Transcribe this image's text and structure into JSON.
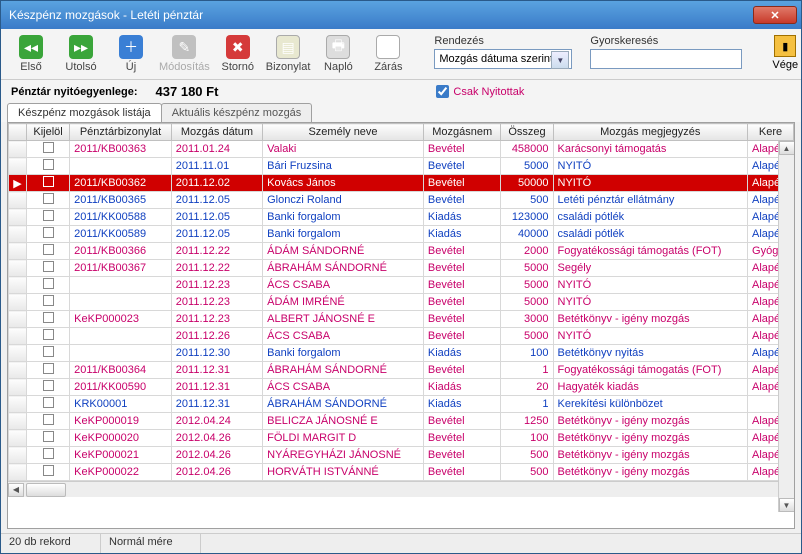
{
  "window": {
    "title": "Készpénz mozgások - Letéti pénztár"
  },
  "toolbar": {
    "first": "Első",
    "last": "Utolsó",
    "new": "Új",
    "edit": "Módosítás",
    "storno": "Stornó",
    "receipt": "Bizonylat",
    "log": "Napló",
    "close": "Zárás",
    "sort_label": "Rendezés",
    "sort_value": "Mozgás dátuma szerint",
    "search_label": "Gyorskeresés",
    "search_value": "",
    "end": "Vége"
  },
  "balance": {
    "label": "Pénztár nyitóegyenlege:",
    "value": "437 180 Ft"
  },
  "filter": {
    "only_open": "Csak Nyitottak",
    "checked": true
  },
  "tabs": {
    "active": "Készpénz mozgások listája",
    "other": "Aktuális készpénz mozgás"
  },
  "columns": [
    "Kijelöl",
    "Pénztárbizonylat",
    "Mozgás dátum",
    "Személy neve",
    "Mozgásnem",
    "Összeg",
    "Mozgás megjegyzés",
    "Kere"
  ],
  "rows": [
    {
      "c": "pink",
      "sel": false,
      "biz": "2011/KB00363",
      "dat": "2011.01.24",
      "nev": "Valaki",
      "nem": "Bevétel",
      "ossz": "458000",
      "meg": "Karácsonyi támogatás",
      "ker": "Alapér"
    },
    {
      "c": "blue",
      "sel": false,
      "biz": "",
      "dat": "2011.11.01",
      "nev": "Bári Fruzsina",
      "nem": "Bevétel",
      "ossz": "5000",
      "meg": "NYITÓ",
      "ker": "Alapér"
    },
    {
      "c": "pink",
      "sel": true,
      "biz": "2011/KB00362",
      "dat": "2011.12.02",
      "nev": "Kovács János",
      "nem": "Bevétel",
      "ossz": "50000",
      "meg": "NYITÓ",
      "ker": "Alapér"
    },
    {
      "c": "blue",
      "sel": false,
      "biz": "2011/KB00365",
      "dat": "2011.12.05",
      "nev": "Glonczi Roland",
      "nem": "Bevétel",
      "ossz": "500",
      "meg": "Letéti pénztár ellátmány",
      "ker": "Alapér"
    },
    {
      "c": "blue",
      "sel": false,
      "biz": "2011/KK00588",
      "dat": "2011.12.05",
      "nev": "Banki forgalom",
      "nem": "Kiadás",
      "ossz": "123000",
      "meg": "családi pótlék",
      "ker": "Alapér"
    },
    {
      "c": "blue",
      "sel": false,
      "biz": "2011/KK00589",
      "dat": "2011.12.05",
      "nev": "Banki forgalom",
      "nem": "Kiadás",
      "ossz": "40000",
      "meg": "családi pótlék",
      "ker": "Alapér"
    },
    {
      "c": "pink",
      "sel": false,
      "biz": "2011/KB00366",
      "dat": "2011.12.22",
      "nev": "ÁDÁM SÁNDORNÉ",
      "nem": "Bevétel",
      "ossz": "2000",
      "meg": "Fogyatékossági támogatás (FOT)",
      "ker": "Gyógy"
    },
    {
      "c": "pink",
      "sel": false,
      "biz": "2011/KB00367",
      "dat": "2011.12.22",
      "nev": "ÁBRAHÁM SÁNDORNÉ",
      "nem": "Bevétel",
      "ossz": "5000",
      "meg": "Segély",
      "ker": "Alapér"
    },
    {
      "c": "pink",
      "sel": false,
      "biz": "",
      "dat": "2011.12.23",
      "nev": "ÁCS CSABA",
      "nem": "Bevétel",
      "ossz": "5000",
      "meg": "NYITÓ",
      "ker": "Alapér"
    },
    {
      "c": "pink",
      "sel": false,
      "biz": "",
      "dat": "2011.12.23",
      "nev": "ÁDÁM IMRÉNÉ",
      "nem": "Bevétel",
      "ossz": "5000",
      "meg": "NYITÓ",
      "ker": "Alapér"
    },
    {
      "c": "pink",
      "sel": false,
      "biz": "KeKP000023",
      "dat": "2011.12.23",
      "nev": "ALBERT JÁNOSNÉ   E",
      "nem": "Bevétel",
      "ossz": "3000",
      "meg": "Betétkönyv - igény mozgás",
      "ker": "Alapér"
    },
    {
      "c": "pink",
      "sel": false,
      "biz": "",
      "dat": "2011.12.26",
      "nev": "ÁCS CSABA",
      "nem": "Bevétel",
      "ossz": "5000",
      "meg": "NYITÓ",
      "ker": "Alapér"
    },
    {
      "c": "blue",
      "sel": false,
      "biz": "",
      "dat": "2011.12.30",
      "nev": "Banki forgalom",
      "nem": "Kiadás",
      "ossz": "100",
      "meg": "Betétkönyv nyitás",
      "ker": "Alapér"
    },
    {
      "c": "pink",
      "sel": false,
      "biz": "2011/KB00364",
      "dat": "2011.12.31",
      "nev": "ÁBRAHÁM SÁNDORNÉ",
      "nem": "Bevétel",
      "ossz": "1",
      "meg": "Fogyatékossági támogatás (FOT)",
      "ker": "Alapér"
    },
    {
      "c": "pink",
      "sel": false,
      "biz": "2011/KK00590",
      "dat": "2011.12.31",
      "nev": "ÁCS CSABA",
      "nem": "Kiadás",
      "ossz": "20",
      "meg": "Hagyaték kiadás",
      "ker": "Alapér"
    },
    {
      "c": "blue",
      "sel": false,
      "biz": "KRK00001",
      "dat": "2011.12.31",
      "nev": "ÁBRAHÁM SÁNDORNÉ",
      "nem": "Kiadás",
      "ossz": "1",
      "meg": "Kerekítési különbözet",
      "ker": ""
    },
    {
      "c": "pink",
      "sel": false,
      "biz": "KeKP000019",
      "dat": "2012.04.24",
      "nev": "BELICZA JÁNOSNÉ   E",
      "nem": "Bevétel",
      "ossz": "1250",
      "meg": "Betétkönyv - igény mozgás",
      "ker": "Alapér"
    },
    {
      "c": "pink",
      "sel": false,
      "biz": "KeKP000020",
      "dat": "2012.04.26",
      "nev": "FÖLDI MARGIT   D",
      "nem": "Bevétel",
      "ossz": "100",
      "meg": "Betétkönyv - igény mozgás",
      "ker": "Alapér"
    },
    {
      "c": "pink",
      "sel": false,
      "biz": "KeKP000021",
      "dat": "2012.04.26",
      "nev": "NYÁREGYHÁZI JÁNOSNÉ",
      "nem": "Bevétel",
      "ossz": "500",
      "meg": "Betétkönyv - igény mozgás",
      "ker": "Alapér"
    },
    {
      "c": "pink",
      "sel": false,
      "biz": "KeKP000022",
      "dat": "2012.04.26",
      "nev": "HORVÁTH ISTVÁNNÉ",
      "nem": "Bevétel",
      "ossz": "500",
      "meg": "Betétkönyv - igény mozgás",
      "ker": "Alapér"
    }
  ],
  "status": {
    "count": "20 db rekord",
    "mode": "Normál mére"
  }
}
